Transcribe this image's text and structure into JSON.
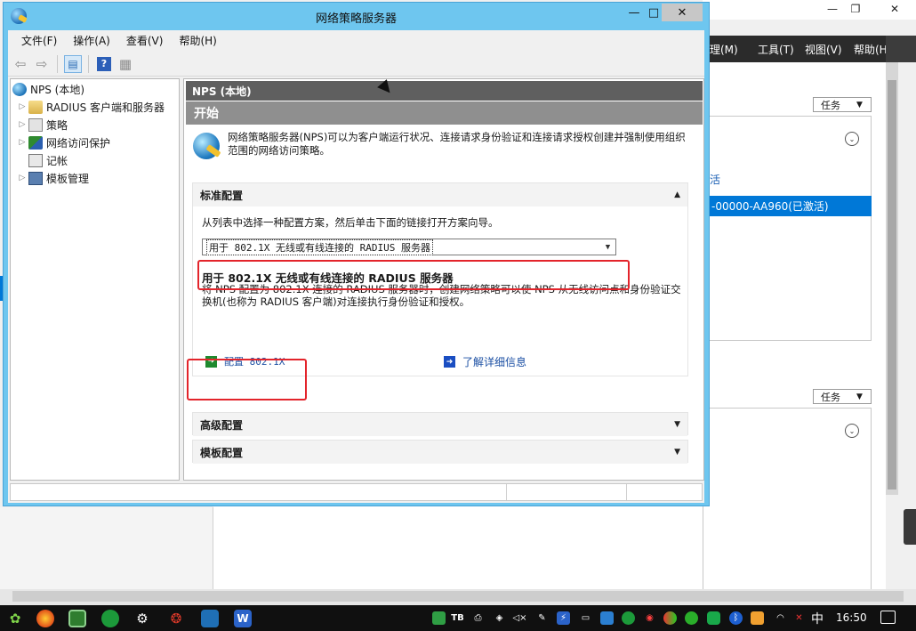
{
  "window": {
    "title": "网络策略服务器",
    "minimize_glyph": "—",
    "maximize_glyph": "□",
    "close_glyph": "✕"
  },
  "menu": [
    "文件(F)",
    "操作(A)",
    "查看(V)",
    "帮助(H)"
  ],
  "toolbar": {
    "back_icon": "⇦",
    "forward_icon": "⇨",
    "console_tree_icon": "▤",
    "help_icon": "?",
    "properties_icon": "▦"
  },
  "tree": {
    "root": "NPS (本地)",
    "items": [
      "RADIUS 客户端和服务器",
      "策略",
      "网络访问保护",
      "记帐",
      "模板管理"
    ]
  },
  "content": {
    "header": "NPS (本地)",
    "subheader": "开始",
    "intro": "网络策略服务器(NPS)可以为客户端运行状况、连接请求身份验证和连接请求授权创建并强制使用组织范围的网络访问策略。",
    "standard": {
      "title": "标准配置",
      "description": "从列表中选择一种配置方案，然后单击下面的链接打开方案向导。",
      "selected_option": "用于 802.1X 无线或有线连接的 RADIUS 服务器",
      "option_title": "用于 802.1X 无线或有线连接的 RADIUS 服务器",
      "option_desc": "将 NPS 配置为 802.1X 连接的 RADIUS 服务器时，创建网络策略可以使 NPS 从无线访问点和身份验证交换机(也称为 RADIUS 客户端)对连接执行身份验证和授权。",
      "configure_link": "配置 802.1X",
      "learn_link": "了解详细信息"
    },
    "advanced_title": "高级配置",
    "template_title": "模板配置"
  },
  "background": {
    "menu": [
      "理(M)",
      "工具(T)",
      "视图(V)",
      "帮助(H)"
    ],
    "tasks_label": "任务",
    "link_fragment": "活",
    "highlight_row": "-00000-AA960(已激活)"
  },
  "taskbar": {
    "ime": "中",
    "time": "16:50"
  },
  "colors": {
    "title_bar": "#6ec6ef",
    "header_dark": "#5f5f5f",
    "header_mid": "#8f8f8f",
    "highlight_red": "#e3242b",
    "link_blue": "#1b4fa3",
    "selection_blue": "#0078d7"
  }
}
